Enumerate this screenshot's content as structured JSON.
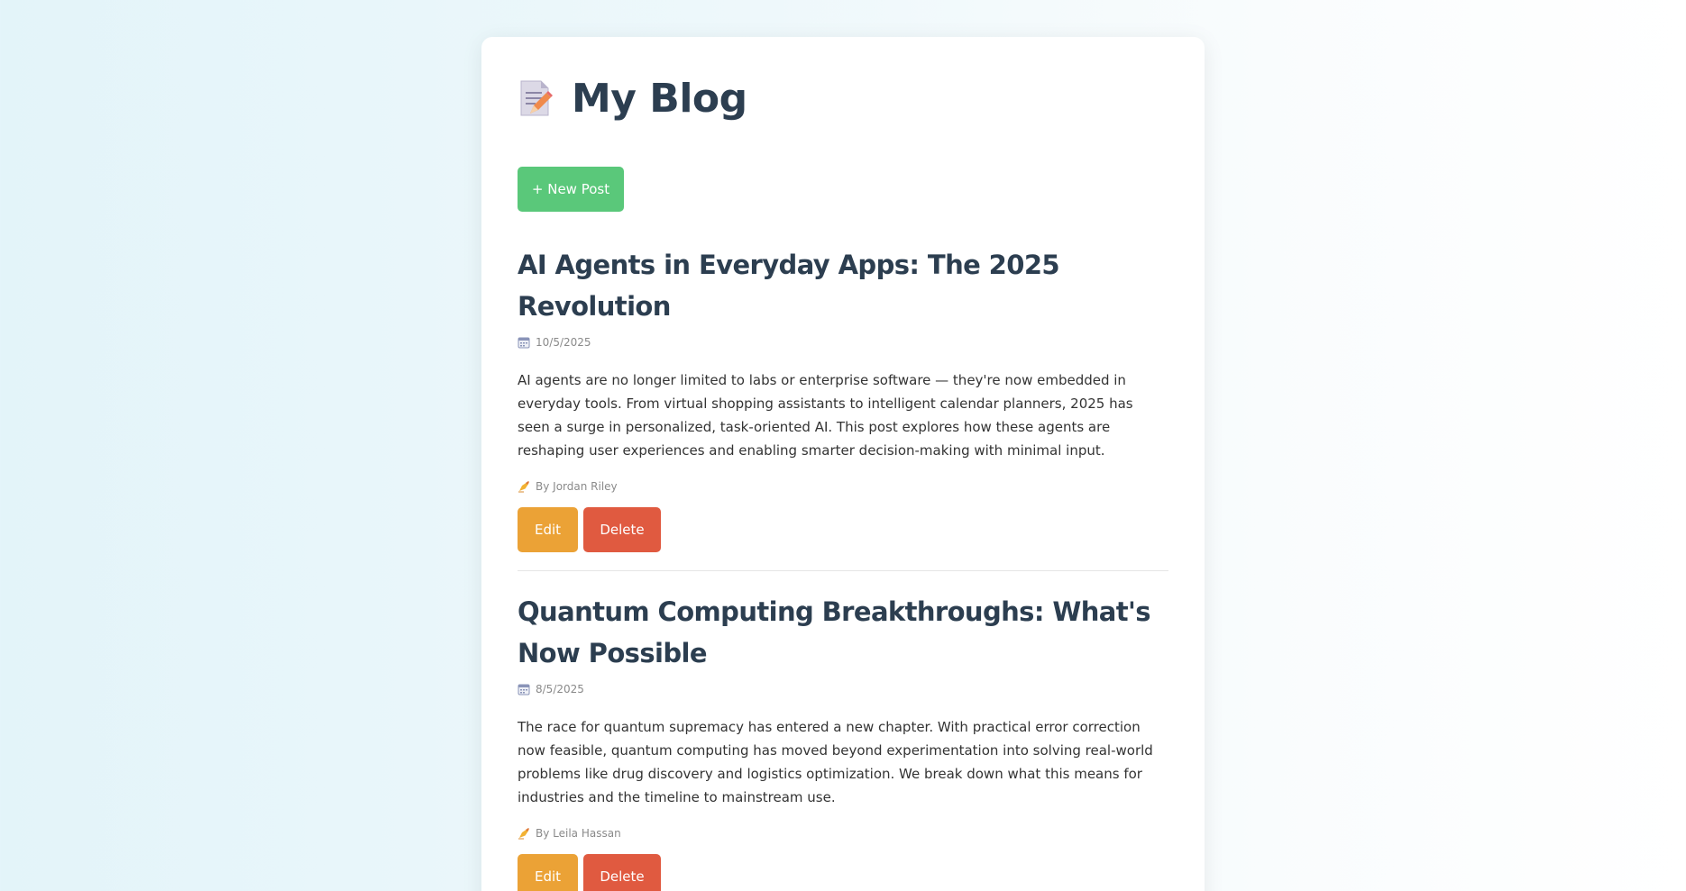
{
  "header": {
    "title": "My Blog",
    "logo_icon": "memo-pencil-icon"
  },
  "toolbar": {
    "new_post_label": "+ New Post"
  },
  "posts": [
    {
      "title": "AI Agents in Everyday Apps: The 2025 Revolution",
      "date": "10/5/2025",
      "date_icon": "calendar-icon",
      "excerpt": "AI agents are no longer limited to labs or enterprise software — they're now embedded in everyday tools. From virtual shopping assistants to intelligent calendar planners, 2025 has seen a surge in personalized, task-oriented AI. This post explores how these agents are reshaping user experiences and enabling smarter decision-making with minimal input.",
      "author": "By Jordan Riley",
      "author_icon": "writing-hand-icon",
      "edit_label": "Edit",
      "delete_label": "Delete"
    },
    {
      "title": "Quantum Computing Breakthroughs: What's Now Possible",
      "date": "8/5/2025",
      "date_icon": "calendar-icon",
      "excerpt": "The race for quantum supremacy has entered a new chapter. With practical error correction now feasible, quantum computing has moved beyond experimentation into solving real-world problems like drug discovery and logistics optimization. We break down what this means for industries and the timeline to mainstream use.",
      "author": "By Leila Hassan",
      "author_icon": "writing-hand-icon",
      "edit_label": "Edit",
      "delete_label": "Delete"
    }
  ],
  "colors": {
    "new_post": "#5ac87a",
    "edit": "#eba236",
    "delete": "#e05a40",
    "heading": "#2c3e50"
  }
}
